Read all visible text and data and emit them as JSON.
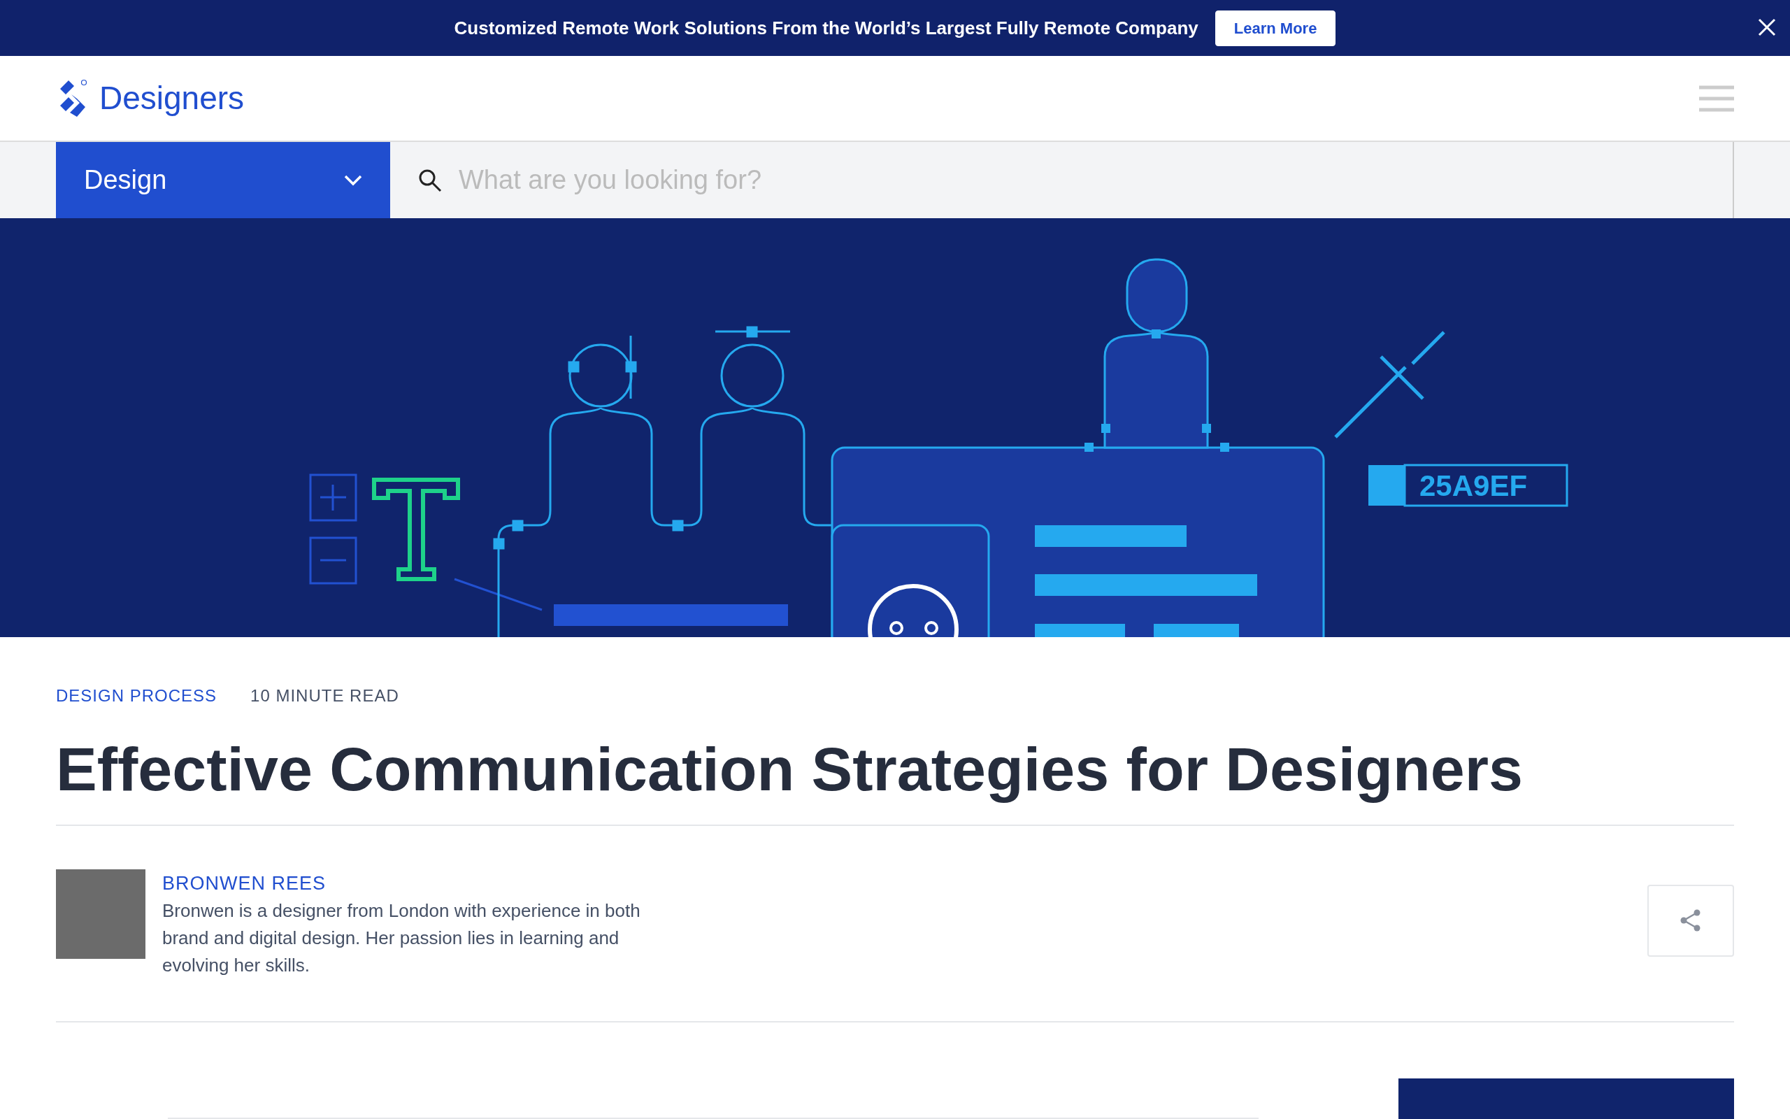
{
  "banner": {
    "message": "Customized Remote Work Solutions From the World’s Largest Fully Remote Company",
    "button": "Learn More"
  },
  "header": {
    "logo_text": "Designers"
  },
  "search_bar": {
    "category": "Design",
    "placeholder": "What are you looking for?"
  },
  "hero": {
    "color_code": "25A9EF"
  },
  "article": {
    "category": "DESIGN PROCESS",
    "read_time": "10 MINUTE READ",
    "title": "Effective Communication Strategies for Designers",
    "author": {
      "name": "BRONWEN REES",
      "bio": "Bronwen is a designer from London with experience in both brand and digital design. Her passion lies in learning and evolving her skills."
    }
  }
}
